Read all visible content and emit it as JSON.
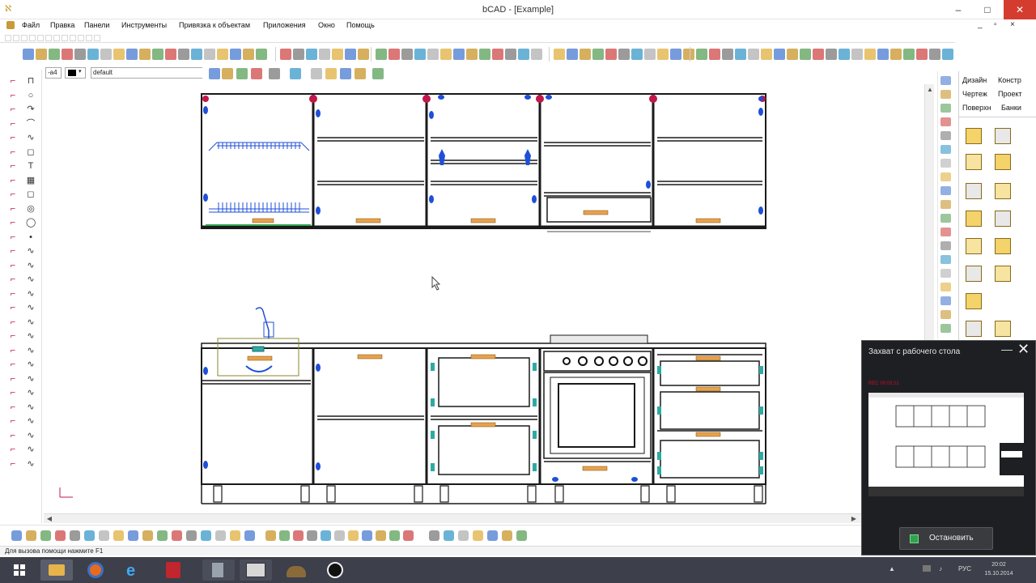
{
  "window": {
    "title": "bCAD - [Example]",
    "minimize": "–",
    "maximize": "□",
    "close": "✕",
    "app_icon": "bcad-logo-icon"
  },
  "menu": {
    "items": [
      "Файл",
      "Правка",
      "Панели",
      "Инструменты",
      "Привязка к объектам",
      "Приложения",
      "Окно",
      "Помощь"
    ]
  },
  "mdi": {
    "minimize": "_",
    "restore": "▫",
    "close": "×"
  },
  "properties": {
    "line_width": "-a4",
    "line_style": "default"
  },
  "right_panel": {
    "tabs": [
      [
        "Дизайн",
        "Констр"
      ],
      [
        "Чертеж",
        "Проект"
      ],
      [
        "Поверхн",
        "Банки"
      ]
    ]
  },
  "status": {
    "hint": "Для вызова помощи нажмите F1"
  },
  "taskbar": {
    "tray_lang": "РУС",
    "clock_time": "20:02",
    "clock_date": "15.10.2014"
  },
  "capture_panel": {
    "title": "Захват с рабочего стола",
    "recording_indicator": "REC 00:03:21",
    "stop_label": "Остановить",
    "minimize": "—",
    "close": "✕"
  },
  "colors": {
    "frame": "#1a1a1a",
    "hardware_blue": "#1f4fd8",
    "hinge_red": "#c0184a",
    "handle_orange": "#e8a24a",
    "accent_green": "#2ea44f",
    "taskbar": "#3d3f4a"
  }
}
